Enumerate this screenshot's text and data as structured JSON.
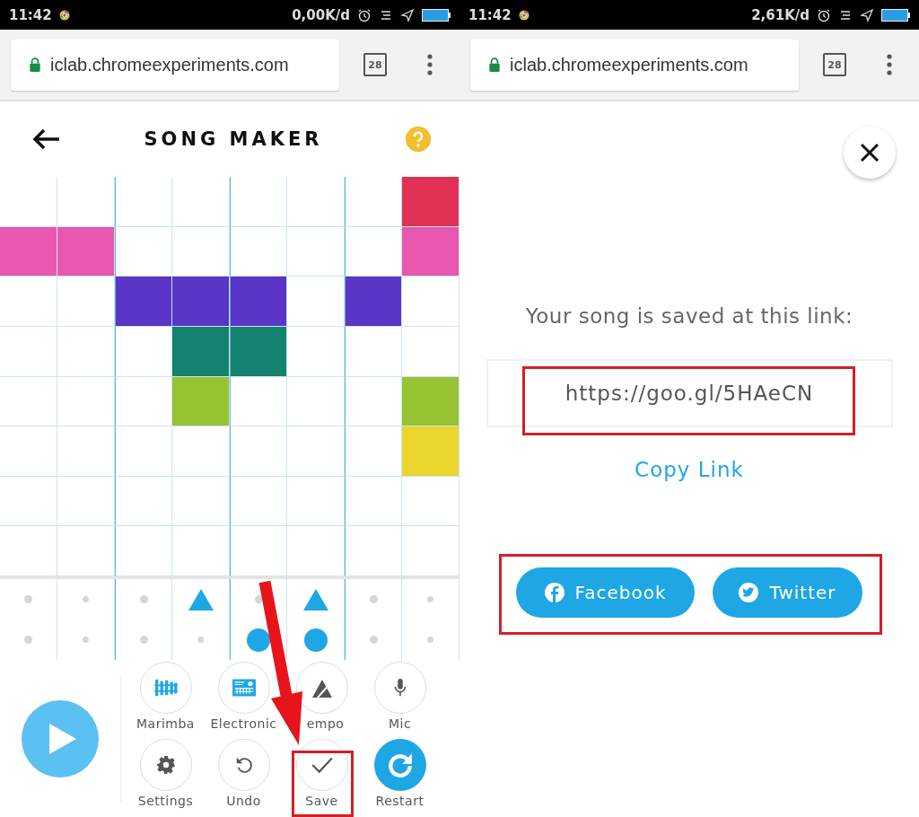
{
  "song_maker_screen": {
    "status_bar": {
      "time": "11:42",
      "speed": "0,00K/d"
    },
    "browser": {
      "url": "iclab.chromeexperiments.com",
      "tab_count": "28"
    },
    "header": {
      "title": "SONG MAKER"
    },
    "grid": {
      "rows": [
        {
          "cells": [
            {
              "on": false
            },
            {
              "on": false
            },
            {
              "on": false
            },
            {
              "on": false
            },
            {
              "on": false
            },
            {
              "on": false
            },
            {
              "on": false
            },
            {
              "on": true,
              "color": "#e03155"
            }
          ]
        },
        {
          "cells": [
            {
              "on": true,
              "color": "#e757b0"
            },
            {
              "on": true,
              "color": "#e757b0"
            },
            {
              "on": false
            },
            {
              "on": false
            },
            {
              "on": false
            },
            {
              "on": false
            },
            {
              "on": false
            },
            {
              "on": true,
              "color": "#e757b0"
            }
          ]
        },
        {
          "cells": [
            {
              "on": false
            },
            {
              "on": false
            },
            {
              "on": true,
              "color": "#5a35c8"
            },
            {
              "on": true,
              "color": "#5a35c8"
            },
            {
              "on": true,
              "color": "#5a35c8"
            },
            {
              "on": false
            },
            {
              "on": true,
              "color": "#5a35c8"
            },
            {
              "on": false
            }
          ]
        },
        {
          "cells": [
            {
              "on": false
            },
            {
              "on": false
            },
            {
              "on": false
            },
            {
              "on": true,
              "color": "#13826e"
            },
            {
              "on": true,
              "color": "#13826e"
            },
            {
              "on": false
            },
            {
              "on": false
            },
            {
              "on": false
            }
          ]
        },
        {
          "cells": [
            {
              "on": false
            },
            {
              "on": false
            },
            {
              "on": false
            },
            {
              "on": true,
              "color": "#97c232"
            },
            {
              "on": false
            },
            {
              "on": false
            },
            {
              "on": false
            },
            {
              "on": true,
              "color": "#97c232"
            }
          ]
        },
        {
          "cells": [
            {
              "on": false
            },
            {
              "on": false
            },
            {
              "on": false
            },
            {
              "on": false
            },
            {
              "on": false
            },
            {
              "on": false
            },
            {
              "on": false
            },
            {
              "on": true,
              "color": "#ead52c"
            }
          ]
        },
        {
          "cells": [
            {
              "on": false
            },
            {
              "on": false
            },
            {
              "on": false
            },
            {
              "on": false
            },
            {
              "on": false
            },
            {
              "on": false
            },
            {
              "on": false
            },
            {
              "on": false
            }
          ]
        },
        {
          "cells": [
            {
              "on": false
            },
            {
              "on": false
            },
            {
              "on": false
            },
            {
              "on": false
            },
            {
              "on": false
            },
            {
              "on": false
            },
            {
              "on": false
            },
            {
              "on": false
            }
          ]
        }
      ]
    },
    "percussion": {
      "rows": [
        {
          "cells": [
            {
              "kind": "dot"
            },
            {
              "kind": "dot"
            },
            {
              "kind": "dot"
            },
            {
              "kind": "triangle"
            },
            {
              "kind": "dot"
            },
            {
              "kind": "triangle"
            },
            {
              "kind": "dot"
            },
            {
              "kind": "dot"
            }
          ]
        },
        {
          "cells": [
            {
              "kind": "dot"
            },
            {
              "kind": "dot"
            },
            {
              "kind": "dot"
            },
            {
              "kind": "dot"
            },
            {
              "kind": "circle"
            },
            {
              "kind": "circle"
            },
            {
              "kind": "dot"
            },
            {
              "kind": "dot"
            }
          ]
        }
      ]
    },
    "tools": [
      {
        "kind": "marimba",
        "label": "Marimba"
      },
      {
        "kind": "electronic",
        "label": "Electronic"
      },
      {
        "kind": "tempo",
        "label": "empo"
      },
      {
        "kind": "mic",
        "label": "Mic"
      },
      {
        "kind": "settings",
        "label": "Settings"
      },
      {
        "kind": "undo",
        "label": "Undo"
      },
      {
        "kind": "save",
        "label": "Save"
      },
      {
        "kind": "restart",
        "label": "Restart"
      }
    ]
  },
  "share_screen": {
    "status_bar": {
      "time": "11:42",
      "speed": "2,61K/d"
    },
    "browser": {
      "url": "iclab.chromeexperiments.com",
      "tab_count": "28"
    },
    "message": "Your song is saved at this link:",
    "link": "https://goo.gl/5HAeCN",
    "copy_link": "Copy Link",
    "share_buttons": [
      {
        "kind": "facebook",
        "label": "Facebook"
      },
      {
        "kind": "twitter",
        "label": "Twitter"
      }
    ]
  }
}
